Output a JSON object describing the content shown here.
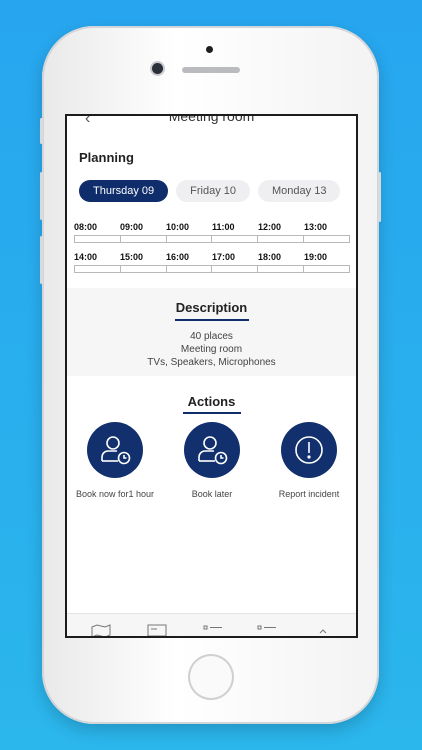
{
  "header": {
    "title": "Meeting room",
    "back_icon": "chevron-left-icon"
  },
  "planning": {
    "title": "Planning",
    "days": [
      {
        "label": "Thursday 09",
        "selected": true
      },
      {
        "label": "Friday 10",
        "selected": false
      },
      {
        "label": "Monday 13",
        "selected": false
      }
    ],
    "row1": [
      "08:00",
      "09:00",
      "10:00",
      "11:00",
      "12:00",
      "13:00"
    ],
    "row2": [
      "14:00",
      "15:00",
      "16:00",
      "17:00",
      "18:00",
      "19:00"
    ]
  },
  "description": {
    "title": "Description",
    "lines": [
      "40 places",
      "Meeting room",
      "TVs, Speakers, Microphones"
    ]
  },
  "actions": {
    "title": "Actions",
    "items": [
      {
        "label": "Book now for1 hour",
        "icon": "user-clock-icon"
      },
      {
        "label": "Book later",
        "icon": "user-clock-icon"
      },
      {
        "label": "Report incident",
        "icon": "alert-circle-icon"
      }
    ]
  },
  "colors": {
    "accent": "#0f2d6b",
    "background": "#27a6ef"
  },
  "tabbar": {
    "icons": [
      "map-icon",
      "id-card-icon",
      "list-icon",
      "list-icon",
      "chevron-up-icon"
    ]
  }
}
